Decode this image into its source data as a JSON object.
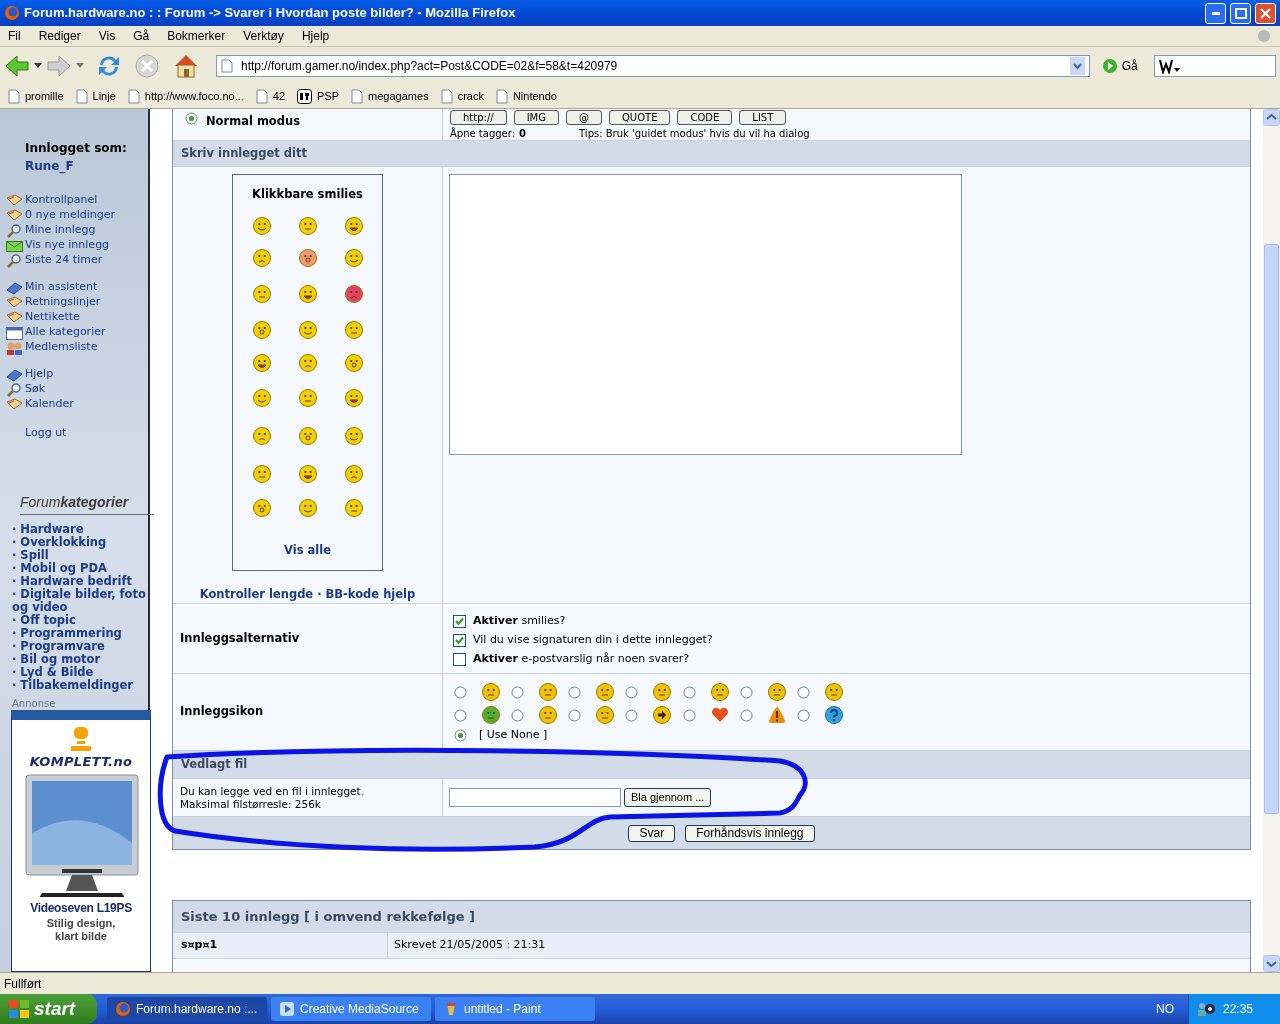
{
  "window": {
    "title": "Forum.hardware.no : : Forum -> Svarer i Hvordan poste bilder? - Mozilla Firefox"
  },
  "menu": [
    "Fil",
    "Rediger",
    "Vis",
    "Gå",
    "Bokmerker",
    "Verktøy",
    "Hjelp"
  ],
  "address": {
    "value": "http://forum.gamer.no/index.php?act=Post&CODE=02&f=58&t=420979",
    "go": "Gå"
  },
  "bookmarks": [
    {
      "label": "promille",
      "kind": "page"
    },
    {
      "label": "Linje",
      "kind": "page"
    },
    {
      "label": "http://www.foco.no...",
      "kind": "page"
    },
    {
      "label": "42",
      "kind": "page"
    },
    {
      "label": "PSP",
      "kind": "app"
    },
    {
      "label": "megagames",
      "kind": "page"
    },
    {
      "label": "crack",
      "kind": "page"
    },
    {
      "label": "Nintendo",
      "kind": "page"
    }
  ],
  "sidebar": {
    "logged_in_label": "Innlogget som:",
    "user": "Rune_F",
    "link_groups": [
      [
        {
          "label": "Kontrollpanel",
          "kind": "book"
        },
        {
          "label": "0 nye meldinger",
          "kind": "book"
        },
        {
          "label": "Mine innlegg",
          "kind": "search"
        },
        {
          "label": "Vis nye innlegg",
          "kind": "mail"
        },
        {
          "label": "Siste 24 timer",
          "kind": "search"
        }
      ],
      [
        {
          "label": "Min assistent",
          "kind": "guide"
        },
        {
          "label": "Retningslinjer",
          "kind": "book"
        },
        {
          "label": "Nettikette",
          "kind": "book"
        },
        {
          "label": "Alle kategorier",
          "kind": "calendar"
        },
        {
          "label": "Medlemsliste",
          "kind": "people"
        }
      ],
      [
        {
          "label": "Hjelp",
          "kind": "guide"
        },
        {
          "label": "Søk",
          "kind": "search"
        },
        {
          "label": "Kalender",
          "kind": "book"
        }
      ]
    ],
    "logout": "Logg ut",
    "categories_title": "Forum**kategorier**",
    "categories": [
      "Hardware",
      "Overklokking",
      "Spill",
      "Mobil og PDA",
      "Hardware bedrift",
      "Digitale bilder, foto og video",
      "Off topic",
      "Programmering",
      "Programvare",
      "Bil og motor",
      "Lyd & Bilde",
      "Tilbakemeldinger"
    ],
    "bullet": "·",
    "ad": {
      "label": "Annonse",
      "brand": "KOMPLETT.no",
      "product": "Videoseven L19PS",
      "tagline": [
        "Stilig design,",
        "klart bilde"
      ]
    }
  },
  "form": {
    "mode": {
      "label": "Normal modus",
      "selected": true
    },
    "tag_buttons": [
      "http://",
      "IMG",
      "@",
      "QUOTE",
      "CODE",
      "LIST"
    ],
    "open_tags_label": "Åpne tagger:",
    "open_tags": "0",
    "tips": "Tips: Bruk 'guidet modus' hvis du vil ha dialog",
    "compose_header": "Skriv innlegget ditt",
    "smilies_title": "Klikkbare smilies",
    "show_all": "Vis alle",
    "help_links": [
      "Kontroller lengde",
      "BB-kode hjelp"
    ],
    "link_separator": "·",
    "options_label": "Innleggsalternativ",
    "options": [
      {
        "label": "**Aktiver** smilies?",
        "checked": true
      },
      {
        "label": "Vil du vise signaturen din i dette innlegget?",
        "checked": true
      },
      {
        "label": "**Aktiver** e-postvarslig når noen svarer?",
        "checked": false
      }
    ],
    "icon_label": "Innleggsikon",
    "post_icons": [
      {
        "kind": "smiley",
        "color": "#f2c200",
        "selected": false
      },
      {
        "kind": "smiley",
        "color": "#f2c200",
        "selected": false
      },
      {
        "kind": "smiley",
        "color": "#f2c200",
        "selected": false
      },
      {
        "kind": "smiley",
        "color": "#f2c200",
        "selected": false
      },
      {
        "kind": "smiley",
        "color": "#f2c200",
        "selected": false
      },
      {
        "kind": "smiley",
        "color": "#f2c200",
        "selected": false
      },
      {
        "kind": "smiley",
        "color": "#f2c200",
        "selected": false
      },
      {
        "kind": "smiley",
        "color": "#52b030",
        "selected": false
      },
      {
        "kind": "smiley",
        "color": "#f2c200",
        "selected": false
      },
      {
        "kind": "smiley",
        "color": "#f2c200",
        "selected": false
      },
      {
        "kind": "arrow",
        "color": "#f2c200",
        "selected": false
      },
      {
        "kind": "heart",
        "color": "#e8501c",
        "selected": false
      },
      {
        "kind": "warning",
        "color": "#f08a00",
        "selected": false
      },
      {
        "kind": "question",
        "color": "#2ea4e0",
        "selected": false
      }
    ],
    "use_none": {
      "label": "[ Use None ]",
      "selected": true
    },
    "attach_header": "Vedlagt fil",
    "attach_text": [
      "Du kan legge ved en fil i innlegget.",
      "Maksimal filstørresle: 256k"
    ],
    "browse": "Bla gjennom ...",
    "buttons": [
      "Svar",
      "Forhåndsvis innlegg"
    ]
  },
  "recent": {
    "title": "Siste 10 innlegg [ i omvend rekkefølge ]",
    "rows": [
      {
        "author": "s¤p¤1",
        "posted": "Skrevet 21/05/2005 : 21:31"
      }
    ]
  },
  "status_bar": "Fullført",
  "taskbar": {
    "start": "start",
    "items": [
      {
        "label": "Forum.hardware.no :...",
        "kind": "firefox",
        "selected": true
      },
      {
        "label": "Creative MediaSource",
        "kind": "media",
        "selected": false
      },
      {
        "label": "untitled - Paint",
        "kind": "paint",
        "selected": false
      }
    ],
    "language": "NO",
    "clock": "22:35"
  }
}
